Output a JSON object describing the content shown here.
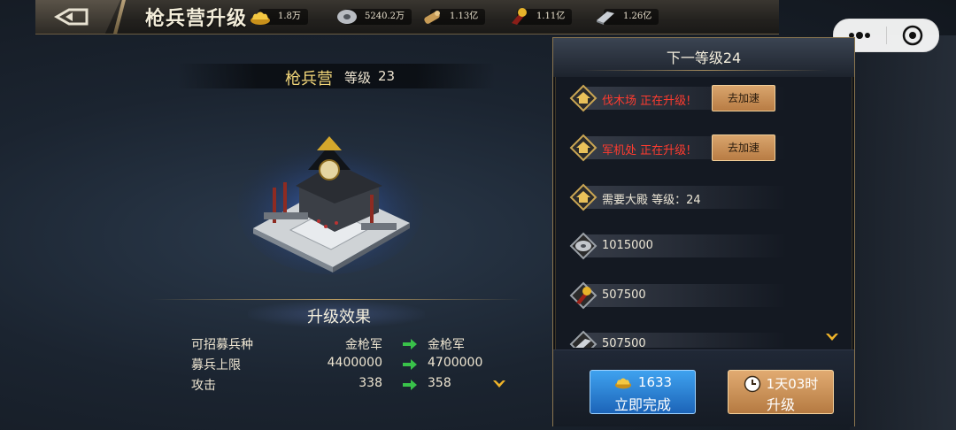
{
  "header": {
    "title": "枪兵营升级",
    "resources": [
      {
        "icon": "gold-ingot-icon",
        "value": "1.8万"
      },
      {
        "icon": "silver-coin-icon",
        "value": "5240.2万"
      },
      {
        "icon": "wood-log-icon",
        "value": "1.13亿"
      },
      {
        "icon": "food-bundle-icon",
        "value": "1.11亿"
      },
      {
        "icon": "iron-ingot-icon",
        "value": "1.26亿"
      }
    ]
  },
  "building": {
    "name": "枪兵营",
    "level_label": "等级",
    "level": "23"
  },
  "effect": {
    "title": "升级效果",
    "rows": [
      {
        "label": "可招募兵种",
        "current": "金枪军",
        "next": "金枪军"
      },
      {
        "label": "募兵上限",
        "current": "4400000",
        "next": "4700000"
      },
      {
        "label": "攻击",
        "current": "338",
        "next": "358"
      }
    ]
  },
  "panel": {
    "title": "下一等级24",
    "requirements": [
      {
        "icon": "building-icon",
        "text": "伐木场 正在升级!",
        "warn": true,
        "button": "去加速"
      },
      {
        "icon": "building-icon",
        "text": "军机处 正在升级!",
        "warn": true,
        "button": "去加速"
      },
      {
        "icon": "building-icon",
        "text": "需要大殿 等级：24",
        "warn": false
      },
      {
        "icon": "silver-coin-icon",
        "text": "1015000",
        "warn": false
      },
      {
        "icon": "food-bundle-icon",
        "text": "507500",
        "warn": false
      },
      {
        "icon": "iron-ingot-icon",
        "text": "507500",
        "warn": false
      }
    ],
    "instant": {
      "cost": "1633",
      "label": "立即完成"
    },
    "upgrade": {
      "time": "1天03时",
      "label": "升级"
    }
  }
}
